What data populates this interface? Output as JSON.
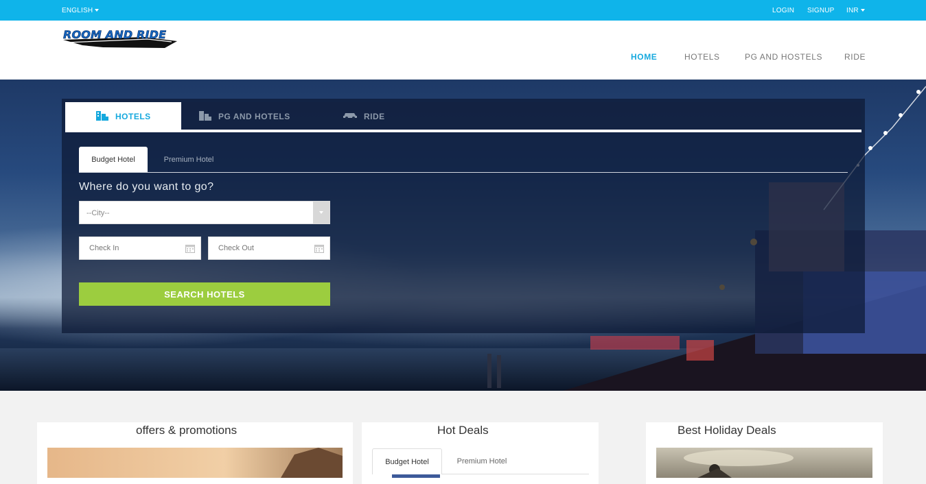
{
  "topbar": {
    "language": "ENGLISH",
    "login": "LOGIN",
    "signup": "SIGNUP",
    "currency": "INR"
  },
  "header": {
    "logo_text": "ROOM AND RIDE",
    "nav": [
      "HOME",
      "HOTELS",
      "PG AND HOSTELS",
      "RIDE"
    ]
  },
  "search": {
    "tabs": [
      "HOTELS",
      "PG AND HOTELS",
      "RIDE"
    ],
    "subtabs": [
      "Budget Hotel",
      "Premium Hotel"
    ],
    "question": "Where do you want to go?",
    "city_placeholder": "--City--",
    "check_in": "Check In",
    "check_out": "Check Out",
    "button": "SEARCH HOTELS"
  },
  "sections": {
    "offers_title": "offers & promotions",
    "hot_deals_title": "Hot Deals",
    "hot_deals_tabs": [
      "Budget Hotel",
      "Premium Hotel"
    ],
    "holiday_title": "Best Holiday Deals"
  },
  "colors": {
    "accent": "#16a9de",
    "topbar": "#0fb4ea",
    "search_button": "#9ccd3f"
  }
}
